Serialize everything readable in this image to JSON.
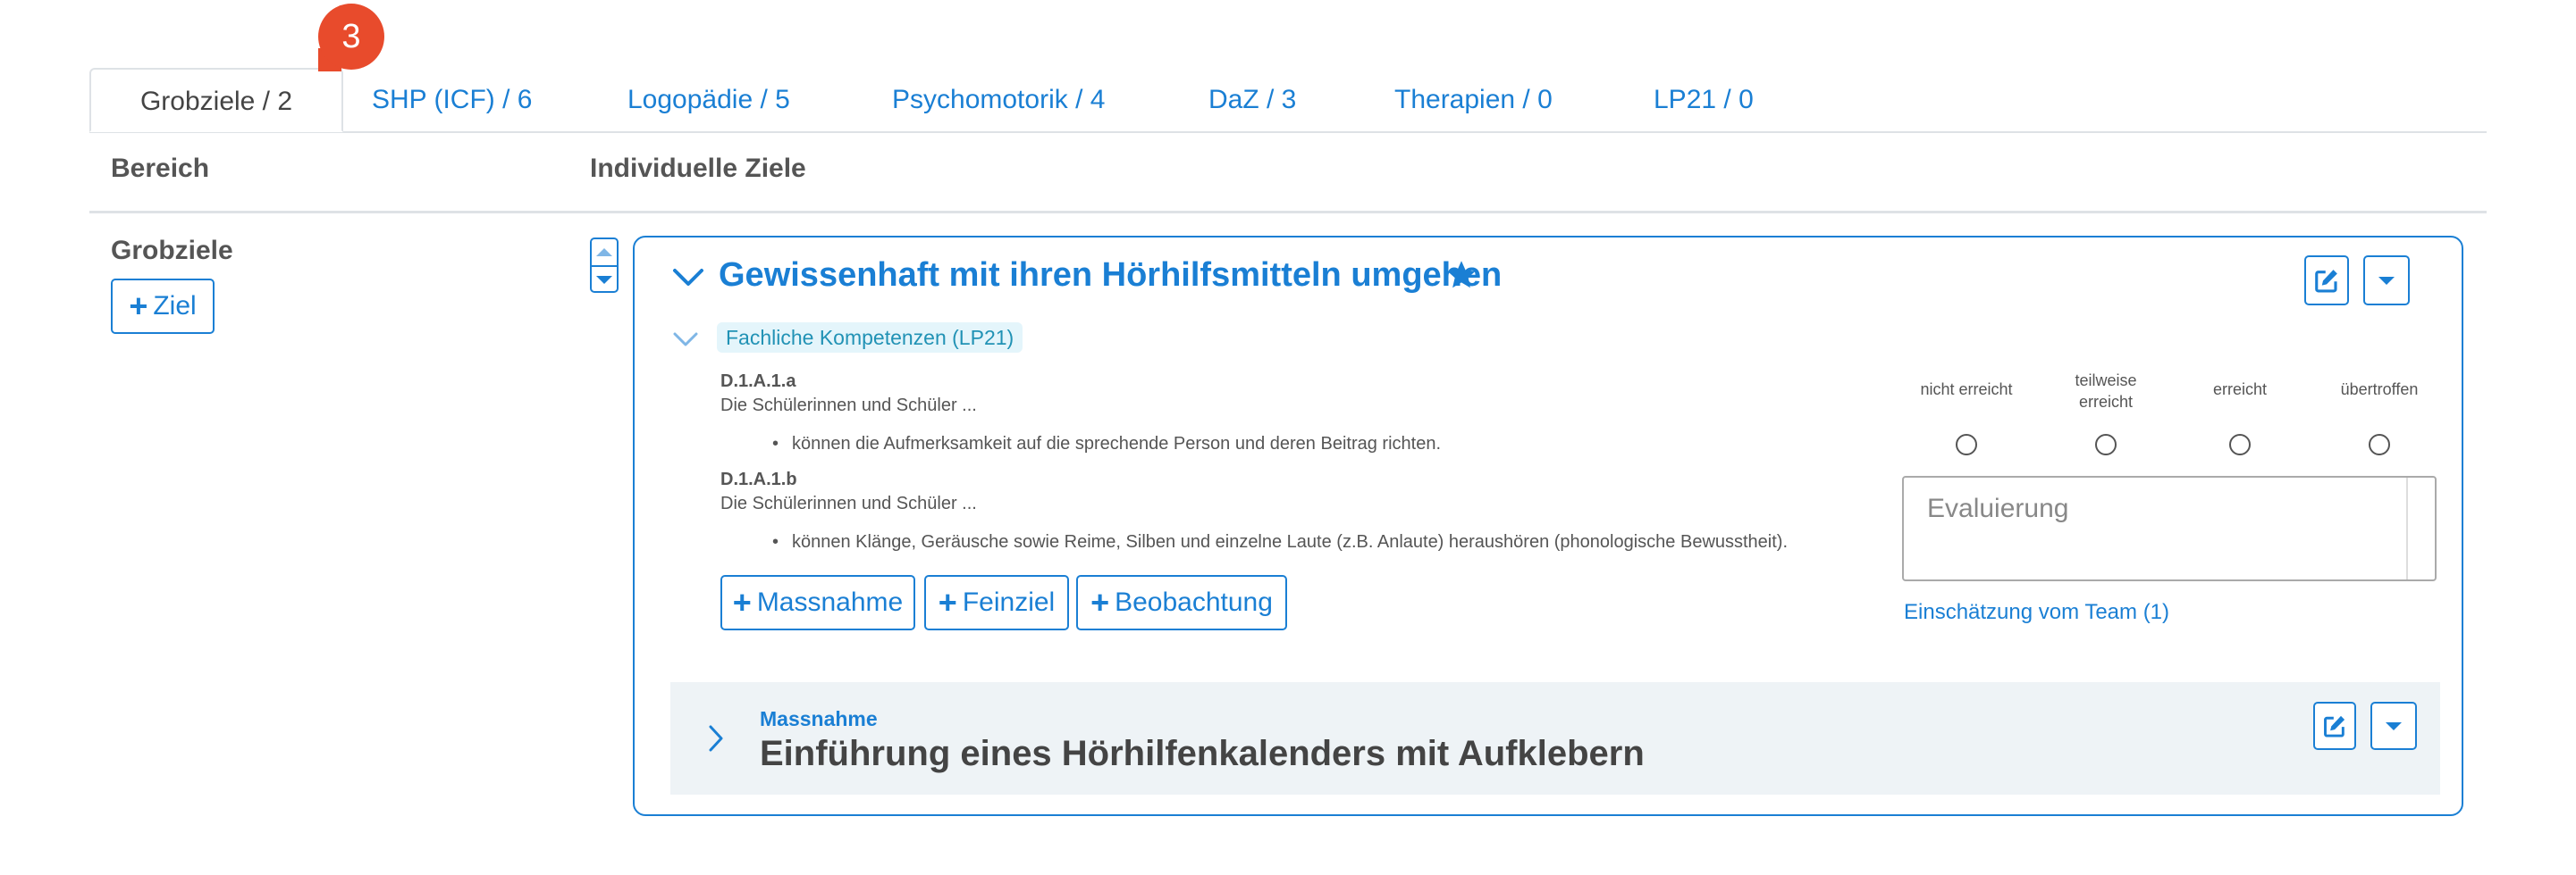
{
  "tabs": [
    {
      "label": "Grobziele / 2",
      "active": true
    },
    {
      "label": "SHP (ICF) / 6"
    },
    {
      "label": "Logopädie / 5"
    },
    {
      "label": "Psychomotorik / 4"
    },
    {
      "label": "DaZ / 3"
    },
    {
      "label": "Therapien / 0"
    },
    {
      "label": "LP21 / 0"
    }
  ],
  "notification_count": "3",
  "columns": {
    "bereich": "Bereich",
    "ziele": "Individuelle Ziele"
  },
  "bereich": {
    "title": "Grobziele",
    "add_label": "Ziel"
  },
  "goal": {
    "title": "Gewissenhaft mit ihren Hörhilfsmitteln umgehen",
    "competence_tag": "Fachliche Kompetenzen (LP21)",
    "competences": [
      {
        "code": "D.1.A.1.a",
        "intro": "Die Schülerinnen und Schüler ...",
        "item": "können die Aufmerksamkeit auf die sprechende Person und deren Beitrag richten."
      },
      {
        "code": "D.1.A.1.b",
        "intro": "Die Schülerinnen und Schüler ...",
        "item": "können Klänge, Geräusche sowie Reime, Silben und einzelne Laute (z.B. Anlaute) heraushören (phonologische Bewusstheit)."
      }
    ],
    "actions": {
      "massnahme": "Massnahme",
      "feinziel": "Feinziel",
      "beobachtung": "Beobachtung"
    },
    "scale": [
      "nicht erreicht",
      "teilweise erreicht",
      "erreicht",
      "übertroffen"
    ],
    "evaluation_placeholder": "Evaluierung",
    "team_link": "Einschätzung vom Team (1)"
  },
  "measure": {
    "label": "Massnahme",
    "title": "Einführung eines Hörhilfenkalenders mit Aufklebern"
  },
  "colors": {
    "accent": "#1a7fd4",
    "badge": "#e84b2c",
    "tag_bg": "#e4f5fb",
    "panel_bg": "#eef3f6"
  }
}
